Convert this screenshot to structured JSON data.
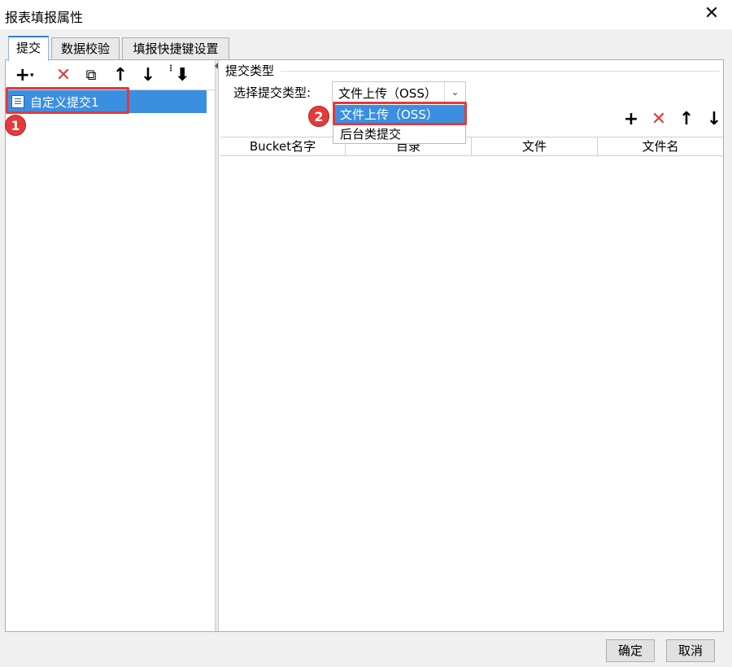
{
  "window": {
    "title": "报表填报属性",
    "close_icon": "close-icon"
  },
  "tabs": [
    {
      "label": "提交",
      "active": true
    },
    {
      "label": "数据校验",
      "active": false
    },
    {
      "label": "填报快捷键设置",
      "active": false
    }
  ],
  "left_toolbar": {
    "items": [
      {
        "name": "add",
        "icon": "plus-dropdown-icon",
        "glyph": "+"
      },
      {
        "name": "delete",
        "icon": "delete-x-icon",
        "glyph": "✕"
      },
      {
        "name": "copy",
        "icon": "copy-icon",
        "glyph": "⧉"
      },
      {
        "name": "move-up",
        "icon": "arrow-up-icon",
        "glyph": "↑"
      },
      {
        "name": "move-down",
        "icon": "arrow-down-icon",
        "glyph": "↓"
      },
      {
        "name": "sort-down",
        "icon": "sort-down-icon",
        "glyph": "⇣"
      }
    ]
  },
  "tree": {
    "items": [
      {
        "label": "自定义提交1",
        "icon": "file-icon",
        "selected": true
      }
    ]
  },
  "annotations": {
    "badge1": "1",
    "badge2": "2",
    "color": "#e03b3b"
  },
  "right": {
    "section_title": "提交类型",
    "select_label": "选择提交类型:",
    "combo_value": "文件上传（OSS）",
    "dropdown_options": [
      {
        "label": "文件上传（OSS）",
        "selected": true
      },
      {
        "label": "后台类提交",
        "selected": false
      }
    ],
    "toolbar": [
      {
        "name": "add",
        "icon": "plus-icon",
        "glyph": "+"
      },
      {
        "name": "delete",
        "icon": "delete-x-icon",
        "glyph": "✕"
      },
      {
        "name": "move-up",
        "icon": "arrow-up-icon",
        "glyph": "↑"
      },
      {
        "name": "move-down",
        "icon": "arrow-down-icon",
        "glyph": "↓"
      }
    ],
    "table": {
      "columns": [
        "Bucket名字",
        "目录",
        "文件",
        "文件名"
      ]
    }
  },
  "footer": {
    "ok_label": "确定",
    "cancel_label": "取消"
  },
  "colors": {
    "selection": "#3b8fe0",
    "tab_accent": "#2f7fd4",
    "delete_red": "#e03b3b"
  }
}
